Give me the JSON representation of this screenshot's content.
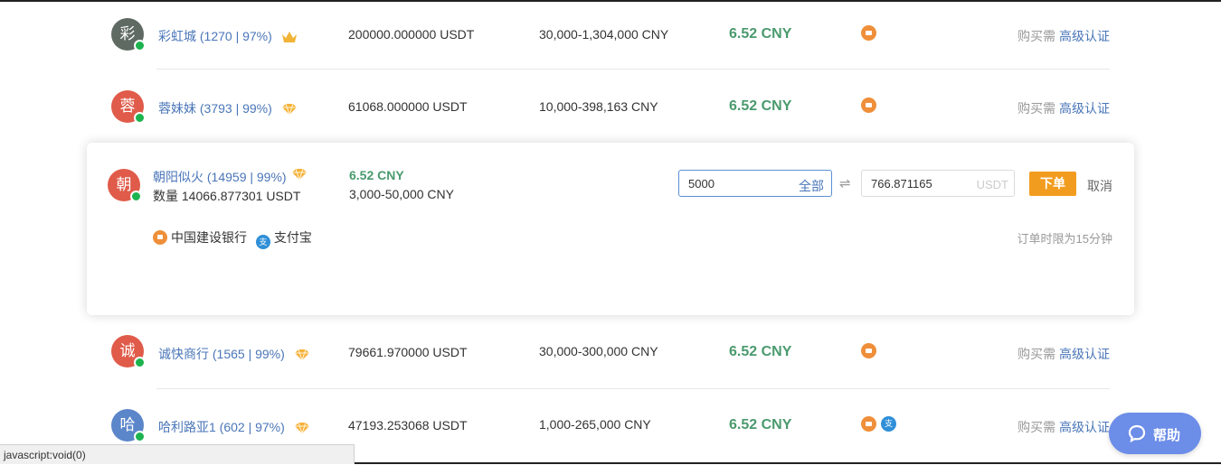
{
  "colors": {
    "link": "#4a76b8",
    "price": "#4a9a6e",
    "order_button": "#f29c1f",
    "bank": "#ef8f3a",
    "alipay": "#2f8fd8",
    "help": "#6c8de8",
    "online": "#1db34f"
  },
  "rows": [
    {
      "avatar_char": "彩",
      "avatar_color": "#5f6a63",
      "name": "彩虹城 (1270 | 97%)",
      "badge": "crown-icon",
      "amount": "200000.000000 USDT",
      "limit": "30,000-1,304,000 CNY",
      "price": "6.52 CNY",
      "req_prefix": "购买需",
      "req_link": "高级认证"
    },
    {
      "avatar_char": "蓉",
      "avatar_color": "#e05b4a",
      "name": "蓉妹妹 (3793 | 99%)",
      "badge": "diamond-icon",
      "amount": "61068.000000 USDT",
      "limit": "10,000-398,163 CNY",
      "price": "6.52 CNY",
      "req_prefix": "购买需",
      "req_link": "高级认证"
    },
    {
      "avatar_char": "诚",
      "avatar_color": "#e05b4a",
      "name": "诚快商行 (1565 | 99%)",
      "badge": "diamond-icon",
      "amount": "79661.970000 USDT",
      "limit": "30,000-300,000 CNY",
      "price": "6.52 CNY",
      "req_prefix": "购买需",
      "req_link": "高级认证"
    },
    {
      "avatar_char": "哈",
      "avatar_color": "#5b86c9",
      "name": "哈利路亚1 (602 | 97%)",
      "badge": "diamond-icon",
      "amount": "47193.253068 USDT",
      "limit": "1,000-265,000 CNY",
      "price": "6.52 CNY",
      "req_prefix": "购买需",
      "req_link": "高级认证"
    }
  ],
  "expanded": {
    "avatar_char": "朝",
    "avatar_color": "#e05b4a",
    "name": "朝阳似火 (14959 | 99%)",
    "badge": "diamond-icon",
    "qty": "数量 14066.877301 USDT",
    "price": "6.52 CNY",
    "limit": "3,000-50,000 CNY",
    "cny_input": "5000",
    "all_label": "全部",
    "usdt_input": "766.871165",
    "usdt_unit": "USDT",
    "order_label": "下单",
    "cancel_label": "取消",
    "pay_bank": "中国建设银行",
    "pay_ali": "支付宝",
    "limit_note": "订单时限为15分钟"
  },
  "alipay_glyph": "支",
  "status_text": "javascript:void(0)",
  "help_label": "帮助"
}
